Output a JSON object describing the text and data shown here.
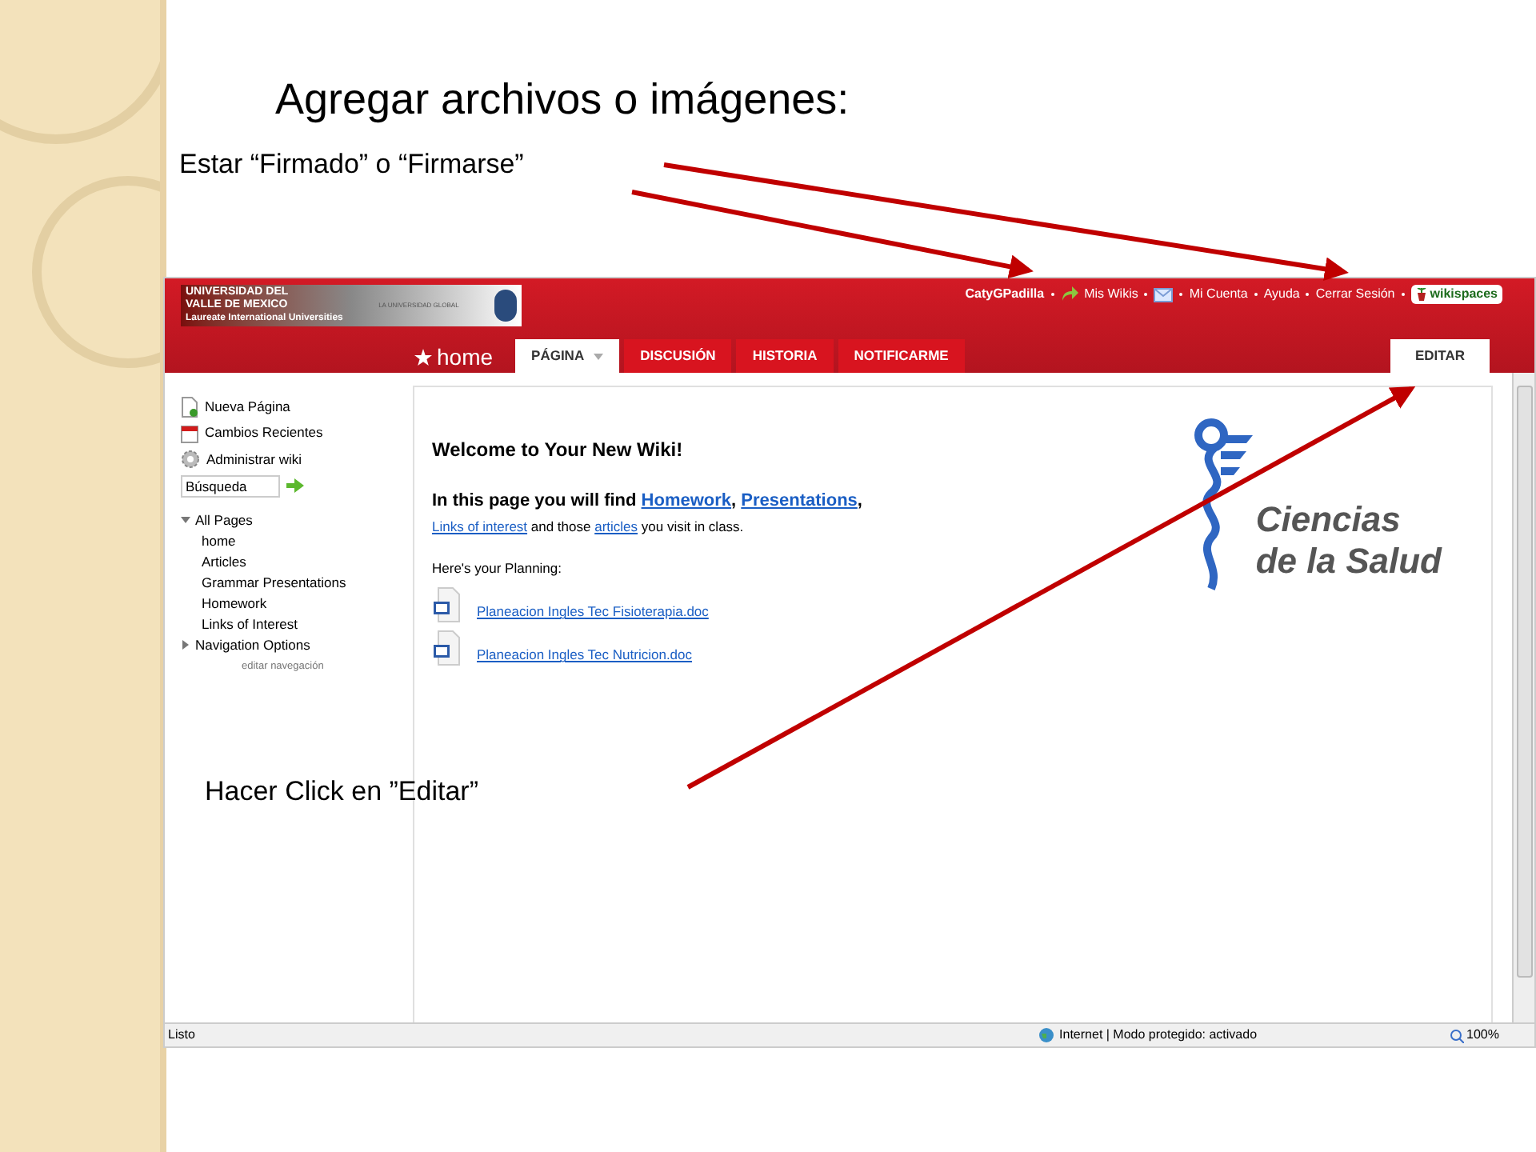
{
  "slide": {
    "title": "Agregar archivos o imágenes:",
    "notes": [
      {
        "text": "Estar “Firmado” o “Firmarse”"
      },
      {
        "text": "Hacer Click en ”Editar”"
      }
    ]
  },
  "browser": {
    "header": {
      "logo_lines": [
        "UNIVERSIDAD DEL",
        "VALLE DE MEXICO",
        "Laureate International Universities"
      ],
      "logo_tagline": "LA UNIVERSIDAD GLOBAL",
      "user_links": [
        {
          "text": "CatyGPadilla",
          "kind": "user"
        },
        {
          "text": "Mis Wikis",
          "kind": "wikis"
        },
        {
          "kind": "mail"
        },
        {
          "text": "Mi Cuenta",
          "kind": "plain"
        },
        {
          "text": "Ayuda",
          "kind": "plain"
        },
        {
          "text": "Cerrar Sesión",
          "kind": "plain"
        }
      ],
      "brand": "wikispaces"
    },
    "home_link": "home",
    "tabs": [
      {
        "label": "PÁGINA",
        "selected": true,
        "dropdown": true
      },
      {
        "label": "DISCUSIÓN",
        "selected": false,
        "dropdown": false
      },
      {
        "label": "HISTORIA",
        "selected": false,
        "dropdown": false
      },
      {
        "label": "NOTIFICARME",
        "selected": false,
        "dropdown": false
      }
    ],
    "edit_button": "EDITAR",
    "sidebar": {
      "actions": [
        {
          "label": "Nueva Página",
          "kind": "page"
        },
        {
          "label": "Cambios Recientes",
          "kind": "calendar"
        },
        {
          "label": "Administrar wiki",
          "kind": "gear"
        }
      ],
      "search": {
        "value": "Búsqueda"
      },
      "tree": [
        {
          "label": "All Pages",
          "expanded": true,
          "children": [
            {
              "label": "home"
            },
            {
              "label": "Articles"
            },
            {
              "label": "Grammar Presentations"
            },
            {
              "label": "Homework"
            },
            {
              "label": "Links of Interest"
            }
          ]
        },
        {
          "label": "Navigation Options",
          "expanded": false
        }
      ],
      "edit_link": "editar navegación"
    },
    "content": {
      "heading": "Welcome to Your New Wiki!",
      "intro": [
        [
          {
            "text": "In this page you will find ",
            "link": false
          },
          {
            "text": "Homework",
            "link": true
          },
          {
            "text": ", ",
            "link": false
          },
          {
            "text": "Presentations",
            "link": true
          },
          {
            "text": ",",
            "link": false
          }
        ],
        [
          {
            "text": "Links of interest",
            "link": true
          },
          {
            "text": " and those ",
            "link": false
          },
          {
            "text": "articles",
            "link": true
          },
          {
            "text": " you visit in class.",
            "link": false
          }
        ]
      ],
      "planning_label": "Here's your Planning:",
      "files": [
        "Planeacion Ingles Tec Fisioterapia.doc",
        "Planeacion Ingles Tec Nutricion.doc"
      ],
      "logo_text": [
        "Ciencias",
        "de la Salud"
      ]
    },
    "status_bar": {
      "status": "Listo",
      "zone": "Internet | Modo protegido: activado",
      "zoom": "100%"
    }
  }
}
